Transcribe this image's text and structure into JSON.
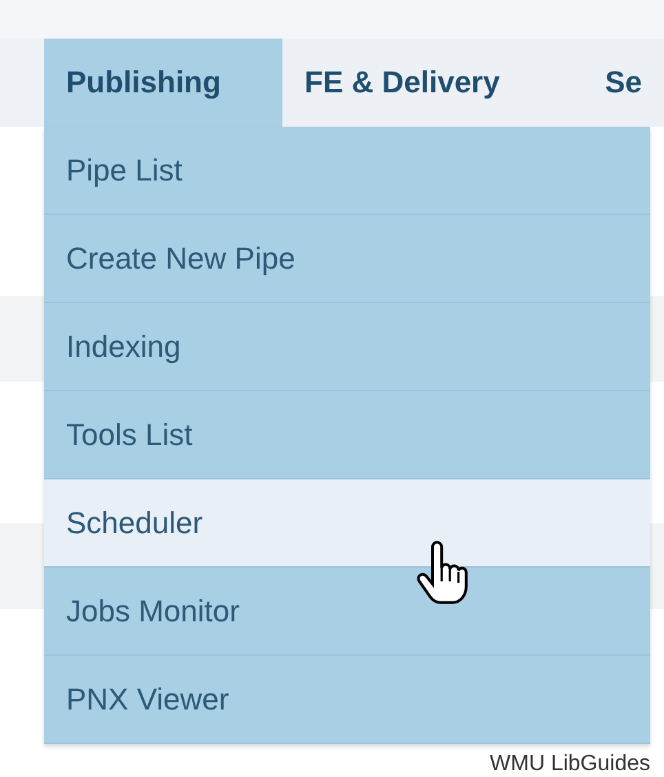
{
  "tabs": [
    {
      "label": "Publishing",
      "selected": true
    },
    {
      "label": "FE & Delivery",
      "selected": false
    },
    {
      "label": "Se",
      "selected": false
    }
  ],
  "menu": {
    "items": [
      {
        "label": "Pipe List",
        "selected": false
      },
      {
        "label": "Create New Pipe",
        "selected": false
      },
      {
        "label": "Indexing",
        "selected": false
      },
      {
        "label": "Tools List",
        "selected": false
      },
      {
        "label": "Scheduler",
        "selected": true
      },
      {
        "label": "Jobs Monitor",
        "selected": false
      },
      {
        "label": "PNX Viewer",
        "selected": false
      }
    ]
  },
  "footer": {
    "text": "WMU LibGuides"
  }
}
